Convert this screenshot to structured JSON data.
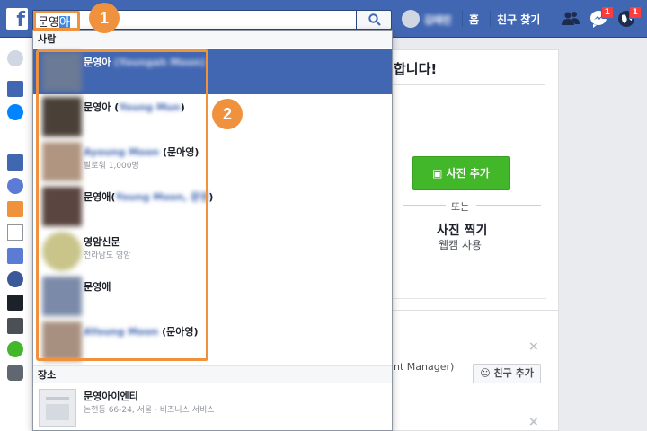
{
  "topbar": {
    "search_query_prefix": "문영",
    "search_query_selected": "아",
    "username": "김태민",
    "nav_home": "홈",
    "nav_find_friends": "친구 찾기",
    "messages_badge": "1",
    "notifications_badge": "1"
  },
  "dropdown": {
    "people_header": "사람",
    "people": [
      {
        "name": "문영아",
        "blurred": " (Youngah Moon)",
        "suffix": "",
        "sub": "",
        "thumb_color": "#6b7a95"
      },
      {
        "name": "문영아 (",
        "blurred": "Young Mun",
        "suffix": ")",
        "sub": "",
        "thumb_color": "#4a4038"
      },
      {
        "name": "",
        "blurred": "Ayoung Moon",
        "suffix": " (문아영)",
        "sub": "팔로워 1,000명",
        "thumb_color": "#b09580"
      },
      {
        "name": "문영애(",
        "blurred": "Young Moon, 문영",
        "suffix": ")",
        "sub": "",
        "thumb_color": "#5a4540"
      },
      {
        "name": "영암신문",
        "blurred": "",
        "suffix": "",
        "sub": "전라남도 영암",
        "thumb_color": "#c8c48a"
      },
      {
        "name": "문영애",
        "blurred": "",
        "suffix": "",
        "sub": "",
        "thumb_color": "#7a8aa8"
      },
      {
        "name": "",
        "blurred": "AYoung Moon",
        "suffix": " (문아영)",
        "sub": "",
        "thumb_color": "#a89080"
      }
    ],
    "places_header": "장소",
    "place": {
      "name": "문영아이엔티",
      "sub": "논현동 66-24, 서울 · 비즈니스 서비스"
    }
  },
  "main": {
    "greeting": "합니다!",
    "add_photo_label": "사진 추가",
    "or_label": "또는",
    "take_photo_label": "사진 찍기",
    "webcam_label": "웹캠 사용",
    "manager_text": "nt Manager)",
    "add_friend_label": "친구 추가",
    "close_glyph": "×"
  },
  "annotations": {
    "step1": "1",
    "step2": "2",
    "color": "#f0913e"
  }
}
